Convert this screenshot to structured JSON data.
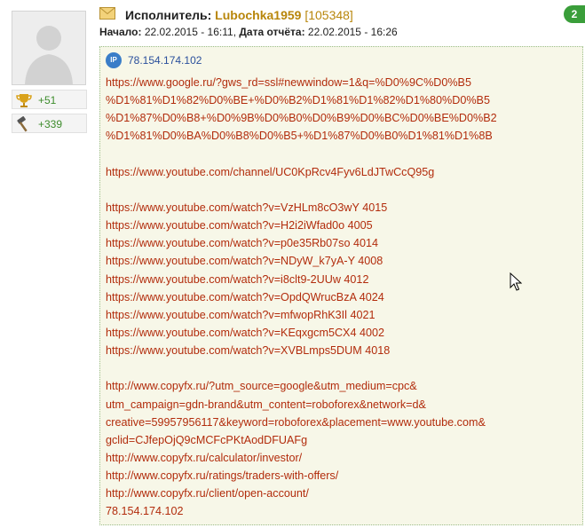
{
  "header": {
    "performer_label": "Исполнитель:",
    "performer_name": "Lubochka1959",
    "performer_id": "[105348]",
    "start_label": "Начало:",
    "start_value": "22.02.2015 - 16:11,",
    "report_label": "Дата отчёта:",
    "report_value": "22.02.2015 - 16:26",
    "badge_text": "2"
  },
  "sidebar": {
    "stats": [
      {
        "icon": "trophy-icon",
        "value": "+51"
      },
      {
        "icon": "hammer-icon",
        "value": "+339"
      }
    ]
  },
  "report": {
    "ip_badge": "IP",
    "ip": "78.154.174.102",
    "google_lines": [
      "https://www.google.ru/?gws_rd=ssl#newwindow=1&q=%D0%9C%D0%B5",
      "%D1%81%D1%82%D0%BE+%D0%B2%D1%81%D1%82%D1%80%D0%B5",
      "%D1%87%D0%B8+%D0%9B%D0%B0%D0%B9%D0%BC%D0%BE%D0%B2",
      "%D1%81%D0%BA%D0%B8%D0%B5+%D1%87%D0%B0%D1%81%D1%8B"
    ],
    "channel_line": "https://www.youtube.com/channel/UC0KpRcv4Fyv6LdJTwCcQ95g",
    "watch_lines": [
      "https://www.youtube.com/watch?v=VzHLm8cO3wY 4015",
      "https://www.youtube.com/watch?v=H2i2iWfad0o 4005",
      "https://www.youtube.com/watch?v=p0e35Rb07so 4014",
      "https://www.youtube.com/watch?v=NDyW_k7yA-Y 4008",
      "https://www.youtube.com/watch?v=i8clt9-2UUw 4012",
      "https://www.youtube.com/watch?v=OpdQWrucBzA 4024",
      "https://www.youtube.com/watch?v=mfwopRhK3Il 4021",
      "https://www.youtube.com/watch?v=KEqxgcm5CX4 4002",
      "https://www.youtube.com/watch?v=XVBLmps5DUM 4018"
    ],
    "copyfx_lines": [
      "http://www.copyfx.ru/?utm_source=google&utm_medium=cpc&",
      "utm_campaign=gdn-brand&utm_content=roboforex&network=d&",
      "creative=59957956117&keyword=roboforex&placement=www.youtube.com&",
      "gclid=CJfepOjQ9cMCFcPKtAodDFUAFg",
      "http://www.copyfx.ru/calculator/investor/",
      "http://www.copyfx.ru/ratings/traders-with-offers/",
      "http://www.copyfx.ru/client/open-account/",
      "78.154.174.102"
    ]
  }
}
